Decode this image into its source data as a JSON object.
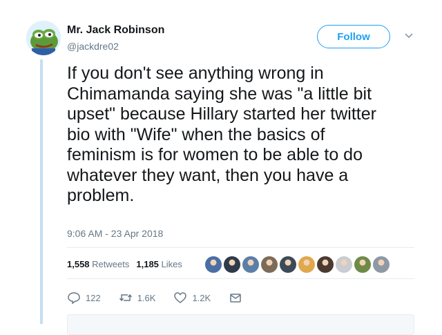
{
  "author": {
    "name": "Mr. Jack Robinson",
    "handle": "@jackdre02",
    "avatar_icon": "pepe-frog-avatar"
  },
  "follow_label": "Follow",
  "tweet": {
    "lines": [
      "If you don't see anything wrong in",
      "Chimamanda saying she was \"a little bit",
      "upset\" because Hillary started her twitter",
      "bio with \"Wife\" when the basics of",
      "feminism is for women to be able to do",
      "whatever they want, then you have a",
      "problem."
    ],
    "timestamp": "9:06 AM - 23 Apr 2018"
  },
  "stats": {
    "retweets_count": "1,558",
    "retweets_label": "Retweets",
    "likes_count": "1,185",
    "likes_label": "Likes"
  },
  "liker_colors": [
    "#4a6fa5",
    "#2f3b4a",
    "#5b7fa8",
    "#7d6b5a",
    "#3d4a57",
    "#e0a84c",
    "#4b3a30",
    "#c9cdd2",
    "#6f8a47",
    "#8e99a5"
  ],
  "actions": {
    "reply_count": "122",
    "retweet_count": "1.6K",
    "like_count": "1.2K"
  },
  "colors": {
    "accent": "#1da1f2",
    "muted": "#657786",
    "thread": "#c4dff2"
  }
}
